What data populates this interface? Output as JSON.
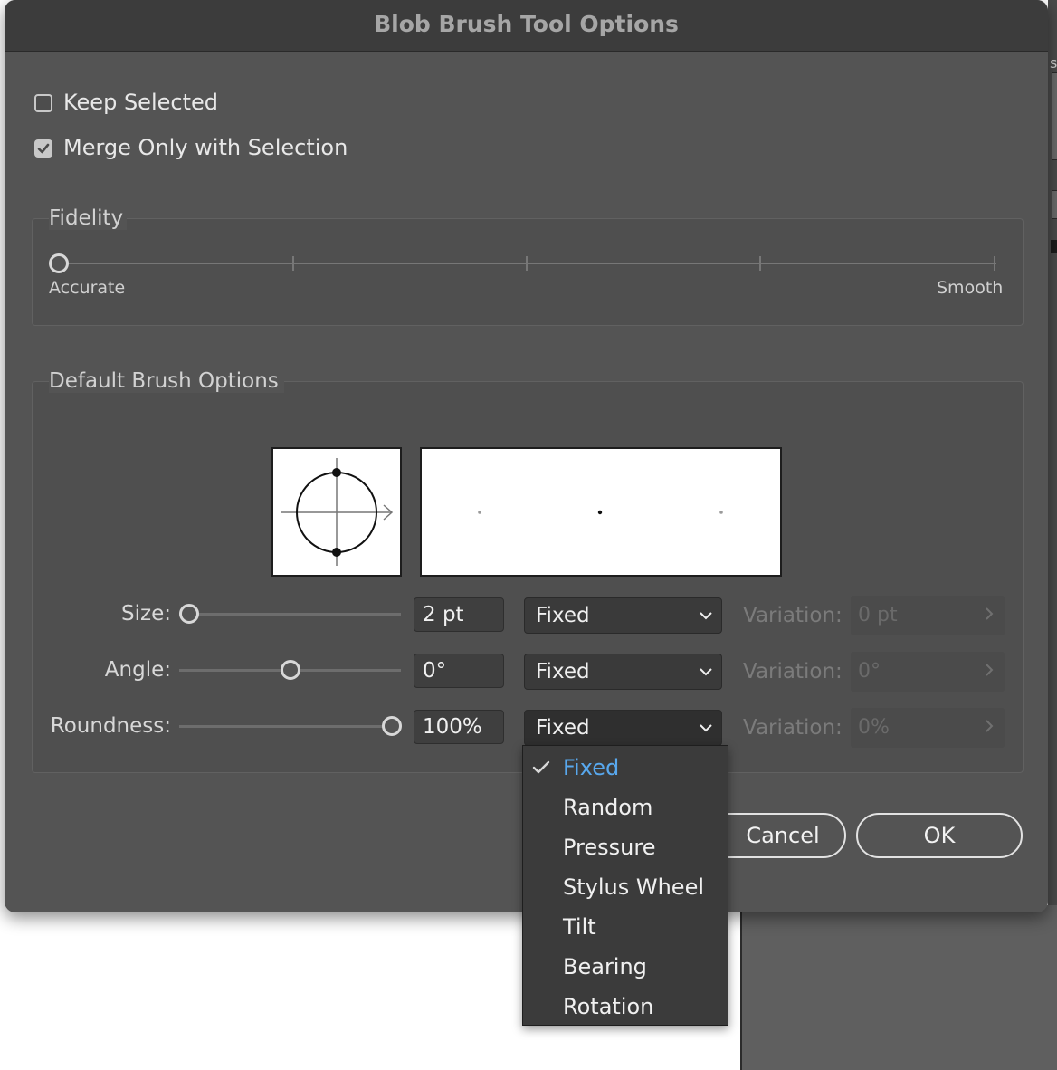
{
  "dialog": {
    "title": "Blob Brush Tool Options",
    "keep_selected": {
      "label": "Keep Selected",
      "checked": false
    },
    "merge_only": {
      "label": "Merge Only with Selection",
      "checked": true
    },
    "fidelity": {
      "title": "Fidelity",
      "left_label": "Accurate",
      "right_label": "Smooth",
      "value": 0
    },
    "brush_options": {
      "title": "Default Brush Options",
      "rows": [
        {
          "label": "Size:",
          "value": "2 pt",
          "mode": "Fixed",
          "variation_label": "Variation:",
          "variation_value": "0 pt",
          "slider_level": 0.0
        },
        {
          "label": "Angle:",
          "value": "0°",
          "mode": "Fixed",
          "variation_label": "Variation:",
          "variation_value": "0°",
          "slider_level": 0.5
        },
        {
          "label": "Roundness:",
          "value": "100%",
          "mode": "Fixed",
          "variation_label": "Variation:",
          "variation_value": "0%",
          "slider_level": 1.0
        }
      ]
    },
    "buttons": {
      "cancel": "Cancel",
      "ok": "OK"
    }
  },
  "dropdown_menu": {
    "selected": "Fixed",
    "items": [
      "Fixed",
      "Random",
      "Pressure",
      "Stylus Wheel",
      "Tilt",
      "Bearing",
      "Rotation"
    ]
  },
  "background": {
    "edge_text": "s"
  },
  "colors": {
    "dialog_bg": "#545454",
    "selected_item": "#58a8ee"
  }
}
